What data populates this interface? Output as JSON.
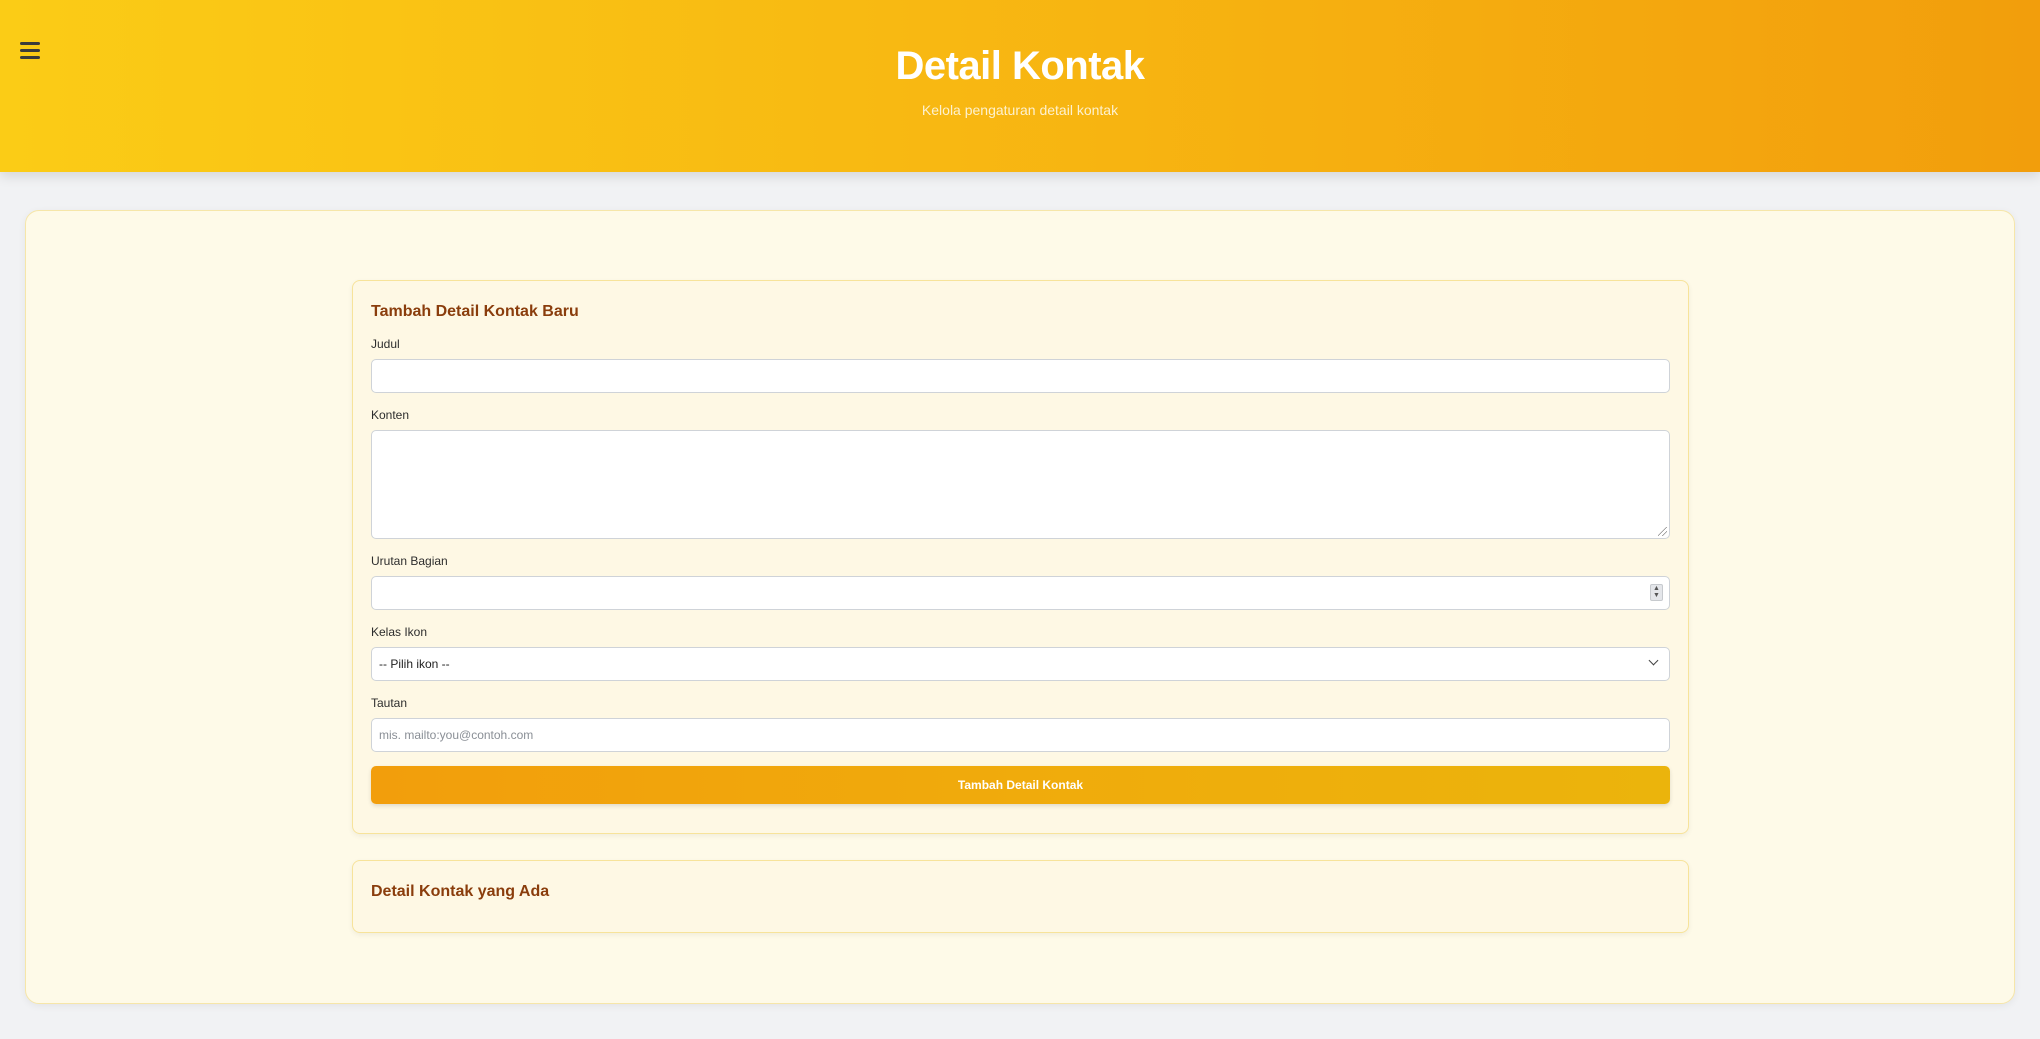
{
  "header": {
    "title": "Detail Kontak",
    "subtitle": "Kelola pengaturan detail kontak",
    "menu_icon": "hamburger-menu-icon"
  },
  "form": {
    "title": "Tambah Detail Kontak Baru",
    "fields": {
      "judul": {
        "label": "Judul",
        "value": "",
        "placeholder": ""
      },
      "konten": {
        "label": "Konten",
        "value": "",
        "placeholder": ""
      },
      "urutan": {
        "label": "Urutan Bagian",
        "value": "",
        "placeholder": ""
      },
      "ikon": {
        "label": "Kelas Ikon",
        "selected": "-- Pilih ikon --"
      },
      "tautan": {
        "label": "Tautan",
        "value": "",
        "placeholder": "mis. mailto:you@contoh.com"
      }
    },
    "submit_label": "Tambah Detail Kontak"
  },
  "existing": {
    "title": "Detail Kontak yang Ada"
  },
  "colors": {
    "header_gradient_start": "#fbcc16",
    "header_gradient_end": "#f29e0c",
    "section_title": "#8a3d0c",
    "card_bg": "#fef8e4"
  }
}
